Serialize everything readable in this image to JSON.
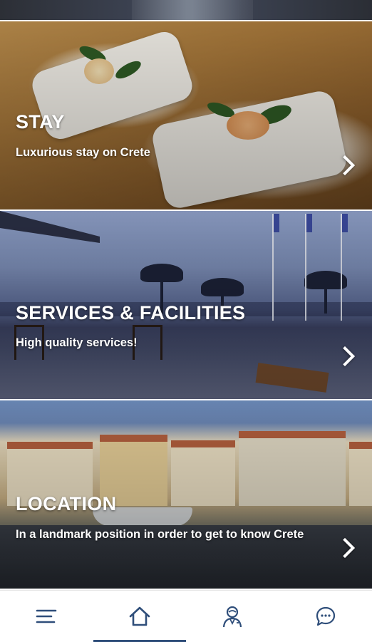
{
  "cards": [
    {
      "title": "STAY",
      "subtitle": "Luxurious stay on Crete"
    },
    {
      "title": "SERVICES & FACILITIES",
      "subtitle": "High quality services!"
    },
    {
      "title": "LOCATION",
      "subtitle": "In a landmark position in order to get to know Crete"
    }
  ],
  "bottom_nav": {
    "items": [
      {
        "icon": "menu-icon",
        "active": false
      },
      {
        "icon": "home-icon",
        "active": true
      },
      {
        "icon": "concierge-icon",
        "active": false
      },
      {
        "icon": "chat-icon",
        "active": false
      }
    ],
    "accent_color": "#2f4e7a",
    "icon_color": "#2f4e7a"
  }
}
